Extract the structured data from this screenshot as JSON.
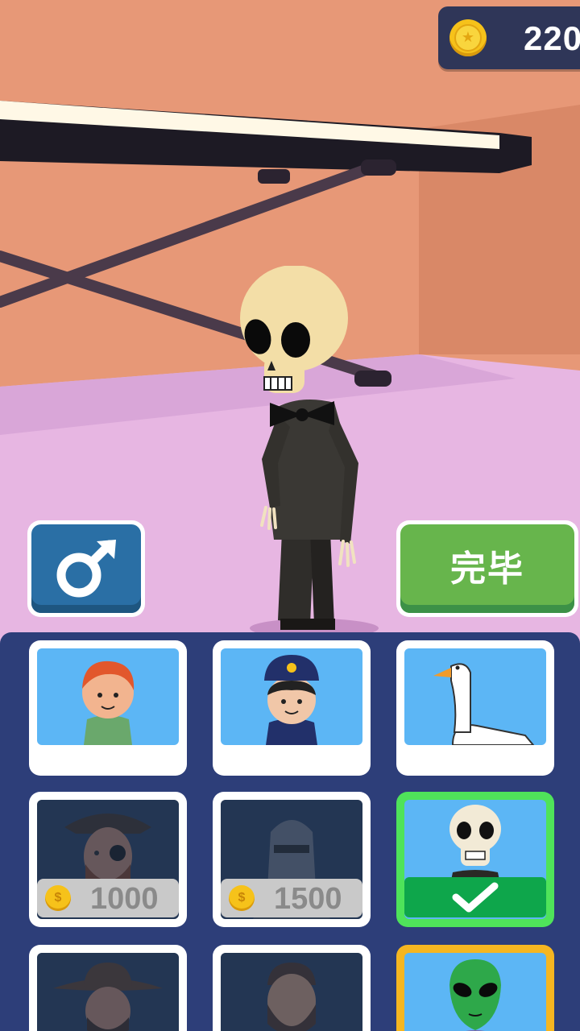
{
  "hud": {
    "coins": "220",
    "coin_icon": "coin-icon"
  },
  "buttons": {
    "gender_icon": "male-symbol-icon",
    "done_label": "完毕"
  },
  "character": {
    "name_icon": "skeleton-in-tuxedo"
  },
  "colors": {
    "panel": "#2d3e79",
    "tile_bg": "#5cb6f5",
    "done_green": "#67b54c",
    "gender_blue": "#2a6fa5",
    "selected_border": "#4fe35a",
    "check_green": "#0ea64b"
  },
  "shop": {
    "items": [
      {
        "icon": "red-hair-boy-icon",
        "state": "owned"
      },
      {
        "icon": "police-officer-icon",
        "state": "owned"
      },
      {
        "icon": "goose-icon",
        "state": "owned"
      },
      {
        "icon": "pirate-icon",
        "state": "locked",
        "price": "1000"
      },
      {
        "icon": "knight-helmet-icon",
        "state": "locked",
        "price": "1500"
      },
      {
        "icon": "skeleton-icon",
        "state": "selected"
      },
      {
        "icon": "cowboy-icon",
        "state": "locked"
      },
      {
        "icon": "bearded-man-icon",
        "state": "locked"
      },
      {
        "icon": "alien-icon",
        "state": "highlight"
      }
    ]
  }
}
